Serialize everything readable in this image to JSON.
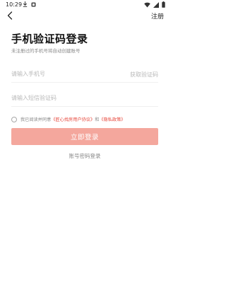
{
  "status_bar": {
    "time": "10:29",
    "left_icons": [
      "download-icon",
      "app-notification-icon"
    ],
    "right_icons": [
      "wifi-icon",
      "signal-icon",
      "battery-icon"
    ]
  },
  "header": {
    "back_icon": "chevron-left-icon",
    "register_label": "注册"
  },
  "title": "手机验证码登录",
  "subtitle": "未注册过的手机号将自动创建账号",
  "phone_field": {
    "placeholder": "请输入手机号",
    "value": "",
    "get_code_label": "获取验证码"
  },
  "code_field": {
    "placeholder": "请输入短信验证码",
    "value": ""
  },
  "agreement": {
    "checked": false,
    "prefix": "我已阅读并同意",
    "user_agreement": "《匠心找房用户协议》",
    "conjunction": "和",
    "privacy_policy": "《隐私政策》"
  },
  "login_button_label": "立即登录",
  "password_login_label": "账号密码登录",
  "colors": {
    "accent": "#e7473b",
    "button_disabled": "#f4a79d",
    "placeholder": "#b8b8b8"
  }
}
